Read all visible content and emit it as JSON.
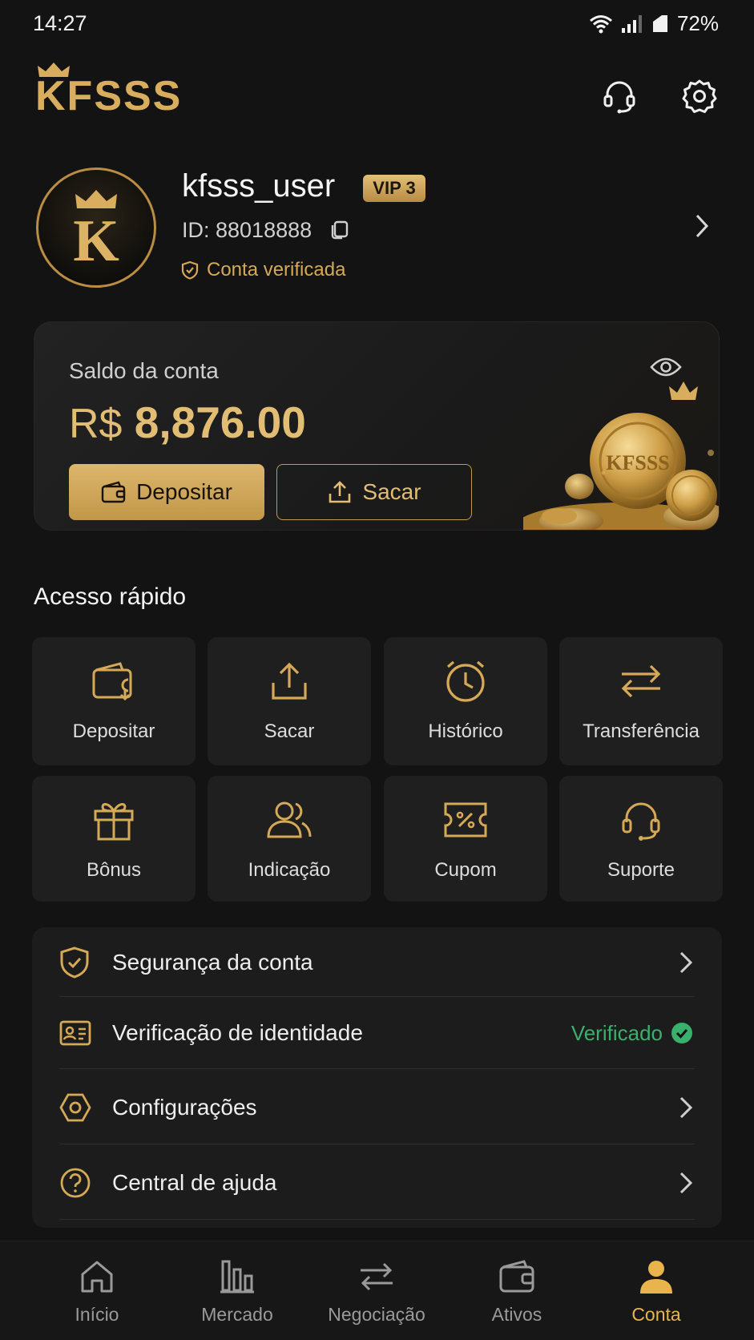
{
  "status_bar": {
    "time": "14:27",
    "battery": "72%"
  },
  "header": {
    "brand": "KFSSS"
  },
  "profile": {
    "username": "kfsss_user",
    "vip": "VIP 3",
    "id_text": "ID: 88018888",
    "verified_text": "Conta verificada",
    "avatar_letter": "K"
  },
  "balance": {
    "label": "Saldo da conta",
    "currency": "R$",
    "amount": "8,876.00",
    "deposit_label": "Depositar",
    "withdraw_label": "Sacar",
    "coin_text": "KFSSS"
  },
  "quick_access": {
    "title": "Acesso rápido",
    "items": [
      {
        "label": "Depositar",
        "icon": "wallet-deposit-icon"
      },
      {
        "label": "Sacar",
        "icon": "upload-icon"
      },
      {
        "label": "Histórico",
        "icon": "clock-icon"
      },
      {
        "label": "Transferência",
        "icon": "transfer-arrows-icon"
      },
      {
        "label": "Bônus",
        "icon": "gift-icon"
      },
      {
        "label": "Indicação",
        "icon": "users-icon"
      },
      {
        "label": "Cupom",
        "icon": "coupon-icon"
      },
      {
        "label": "Suporte",
        "icon": "headset-icon"
      }
    ]
  },
  "menu": {
    "items": [
      {
        "label": "Segurança da conta",
        "icon": "shield-check-icon"
      },
      {
        "label": "Verificação de identidade",
        "icon": "id-card-icon",
        "status": "Verificado"
      },
      {
        "label": "Configurações",
        "icon": "hexagon-gear-icon"
      },
      {
        "label": "Central de ajuda",
        "icon": "question-circle-icon"
      }
    ]
  },
  "bottom_nav": {
    "items": [
      {
        "label": "Início",
        "icon": "home-icon"
      },
      {
        "label": "Mercado",
        "icon": "market-chart-icon"
      },
      {
        "label": "Negociação",
        "icon": "trade-arrows-icon"
      },
      {
        "label": "Ativos",
        "icon": "wallet-icon"
      },
      {
        "label": "Conta",
        "icon": "user-icon",
        "active": true
      }
    ]
  },
  "colors": {
    "background": "#131313",
    "accent_gold": "#d8ae5e",
    "card": "#1f1f1f",
    "verified_green": "#39b06b",
    "active_tab": "#e9b44c"
  }
}
